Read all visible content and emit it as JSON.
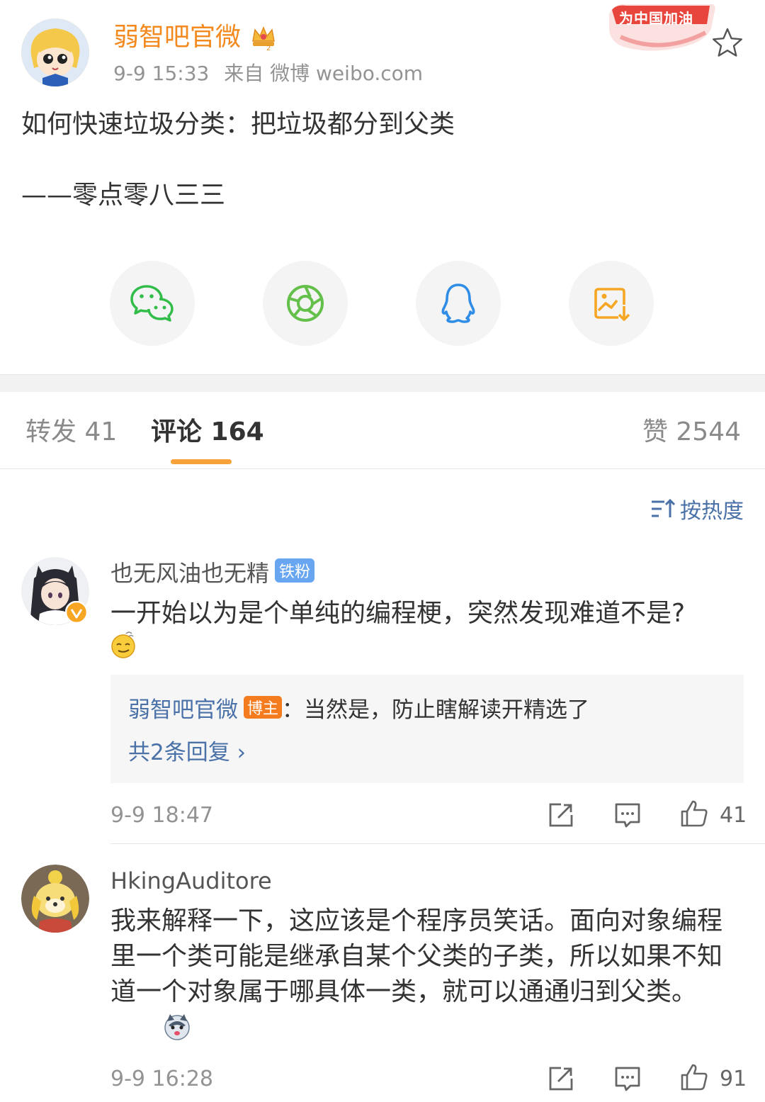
{
  "post": {
    "author": "弱智吧官微",
    "time": "9-9 15:33",
    "source": "来自 微博 weibo.com",
    "badge_text": "为中国加油",
    "line1": "如何快速垃圾分类：把垃圾都分到父类",
    "line2": "——零点零八三三"
  },
  "share": {
    "icons": [
      "wechat-icon",
      "moments-icon",
      "qq-icon",
      "save-image-icon"
    ]
  },
  "tabs": {
    "repost": "转发 41",
    "comments": "评论 164",
    "likes": "赞 2544"
  },
  "sort": {
    "label": "按热度"
  },
  "comments": [
    {
      "user": "也无风油也无精",
      "fan_badge": "铁粉",
      "text": "一开始以为是个单纯的编程梗，突然发现难道不是?",
      "reply_user": "弱智吧官微",
      "reply_badge": "博主",
      "reply_text": "：当然是，防止瞎解读开精选了",
      "reply_count": "共2条回复 ›",
      "time": "9-9 18:47",
      "likes": "41"
    },
    {
      "user": "HkingAuditore",
      "text": "我来解释一下，这应该是个程序员笑话。面向对象编程里一个类可能是继承自某个父类的子类，所以如果不知道一个对象属于哪具体一类，就可以通通归到父类。",
      "time": "9-9 16:28",
      "likes": "91"
    }
  ],
  "colors": {
    "orange": "#f38a1f",
    "link_blue": "#4a71a8",
    "tab_underline": "#f7a33a",
    "wechat_green": "#32bd4a",
    "moments_green": "#65c04b",
    "qq_blue": "#2f8de6",
    "save_orange": "#f5a623"
  }
}
